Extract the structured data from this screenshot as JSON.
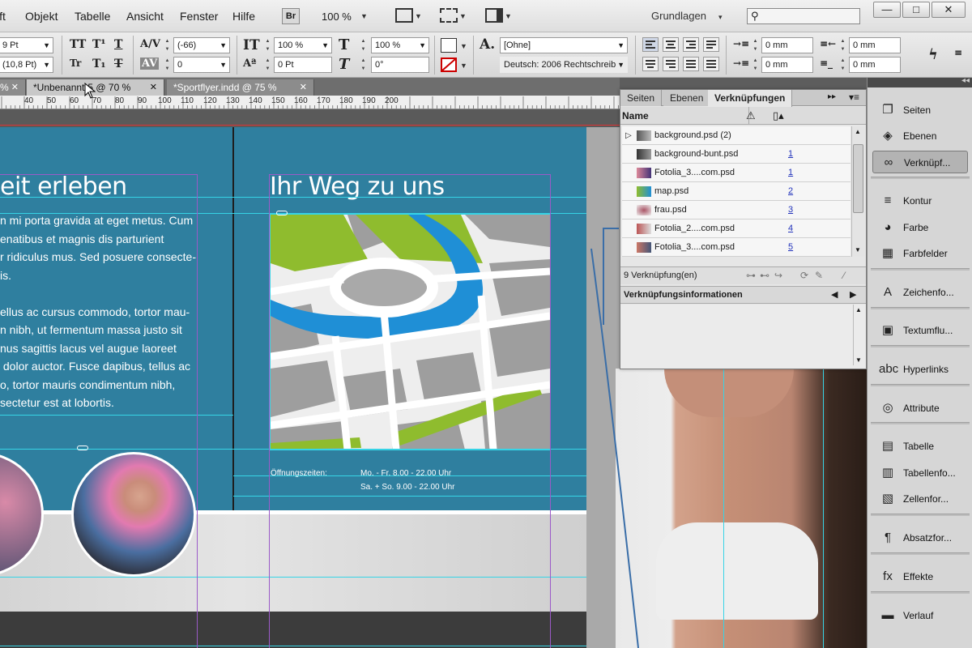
{
  "menubar": {
    "items": [
      "ift",
      "Objekt",
      "Tabelle",
      "Ansicht",
      "Fenster",
      "Hilfe"
    ],
    "br_label": "Br",
    "zoom": "100 %",
    "workspace": "Grundlagen",
    "search_placeholder": "",
    "window_controls": [
      "—",
      "□",
      "✕"
    ]
  },
  "control": {
    "font_size": "9 Pt",
    "leading": "(10,8 Pt)",
    "kerning": "(-66)",
    "tracking": "0",
    "vscale": "100 %",
    "baseline": "0 Pt",
    "hscale": "100 %",
    "skew": "0°",
    "char_style": "[Ohne]",
    "language": "Deutsch: 2006 Rechtschreib",
    "indent_left": "0 mm",
    "indent_right": "0 mm",
    "indent_first": "0 mm",
    "indent_last": "0 mm"
  },
  "tabs": [
    {
      "label": "%",
      "active": false
    },
    {
      "label": "*Unbenannt-5 @ 70 %",
      "active": true
    },
    {
      "label": "*Sportflyer.indd @ 75 %",
      "active": false
    }
  ],
  "ruler": {
    "labels": [
      "40",
      "50",
      "60",
      "70",
      "80",
      "90",
      "100",
      "110",
      "120",
      "130",
      "140",
      "150",
      "160",
      "170",
      "180",
      "190",
      "200"
    ]
  },
  "document": {
    "left_heading": "eit erleben",
    "left_body": "n mi porta gravida at eget metus. Cum\nenatibus et magnis dis parturient\nr ridiculus mus. Sed posuere consecte-\nis.\n\nellus ac cursus commodo, tortor mau-\nn nibh, ut fermentum massa justo sit\nnus sagittis lacus vel augue laoreet\n dolor auctor. Fusce dapibus, tellus ac\no, tortor mauris condimentum nibh,\nsectetur est at lobortis.",
    "right_heading": "Ihr Weg zu uns",
    "hours_label": "Öffnungszeiten:",
    "hours_line1": "Mo. - Fr. 8.00 - 22.00 Uhr",
    "hours_line2": "Sa. + So. 9.00 - 22.00 Uhr"
  },
  "links_panel": {
    "tabs": [
      "Seiten",
      "Ebenen",
      "Verknüpfungen"
    ],
    "col_name": "Name",
    "rows": [
      {
        "name": "background.psd (2)",
        "page": "",
        "expand": true
      },
      {
        "name": "background-bunt.psd",
        "page": "1"
      },
      {
        "name": "Fotolia_3....com.psd",
        "page": "1"
      },
      {
        "name": "map.psd",
        "page": "2"
      },
      {
        "name": "frau.psd",
        "page": "3"
      },
      {
        "name": "Fotolia_2....com.psd",
        "page": "4"
      },
      {
        "name": "Fotolia_3....com.psd",
        "page": "5"
      }
    ],
    "count": "9 Verknüpfung(en)",
    "info_title": "Verknüpfungsinformationen"
  },
  "dock": {
    "items": [
      {
        "label": "Seiten",
        "icon": "pages-icon",
        "glyph": "❐"
      },
      {
        "label": "Ebenen",
        "icon": "layers-icon",
        "glyph": "◈"
      },
      {
        "label": "Verknüpf...",
        "icon": "links-icon",
        "glyph": "∞",
        "selected": true
      },
      {
        "label": "Kontur",
        "icon": "stroke-icon",
        "glyph": "≡"
      },
      {
        "label": "Farbe",
        "icon": "color-icon",
        "glyph": "◕"
      },
      {
        "label": "Farbfelder",
        "icon": "swatches-icon",
        "glyph": "▦"
      },
      {
        "label": "Zeichenfo...",
        "icon": "character-styles-icon",
        "glyph": "A"
      },
      {
        "label": "Textumflu...",
        "icon": "text-wrap-icon",
        "glyph": "▣"
      },
      {
        "label": "Hyperlinks",
        "icon": "hyperlinks-icon",
        "glyph": "abc"
      },
      {
        "label": "Attribute",
        "icon": "attributes-icon",
        "glyph": "◎"
      },
      {
        "label": "Tabelle",
        "icon": "table-icon",
        "glyph": "▤"
      },
      {
        "label": "Tabellenfo...",
        "icon": "table-styles-icon",
        "glyph": "▥"
      },
      {
        "label": "Zellenfor...",
        "icon": "cell-styles-icon",
        "glyph": "▧"
      },
      {
        "label": "Absatzfor...",
        "icon": "paragraph-styles-icon",
        "glyph": "¶"
      },
      {
        "label": "Effekte",
        "icon": "effects-icon",
        "glyph": "fx"
      },
      {
        "label": "Verlauf",
        "icon": "gradient-icon",
        "glyph": "▬"
      }
    ]
  },
  "colors": {
    "page_blue": "#2f7f9f",
    "guide": "#36d4e6",
    "margin": "#9b5ac8",
    "map_green": "#8fbc2e",
    "map_blue": "#1f8fd6"
  }
}
